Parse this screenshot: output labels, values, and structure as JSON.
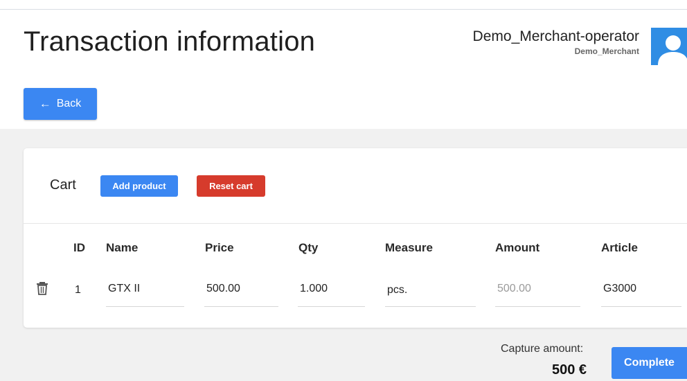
{
  "header": {
    "title": "Transaction information",
    "user_name": "Demo_Merchant-operator",
    "merchant": "Demo_Merchant"
  },
  "back_button": {
    "arrow": "←",
    "label": "Back"
  },
  "cart": {
    "title": "Cart",
    "add_product_label": "Add product",
    "reset_cart_label": "Reset cart",
    "columns": [
      "ID",
      "Name",
      "Price",
      "Qty",
      "Measure",
      "Amount",
      "Article"
    ],
    "rows": [
      {
        "id": "1",
        "name": "GTX II",
        "price": "500.00",
        "qty": "1.000",
        "measure": "pcs.",
        "amount": "500.00",
        "article": "G3000"
      }
    ]
  },
  "footer": {
    "capture_label": "Capture amount:",
    "capture_value": "500 €",
    "complete_label": "Complete"
  },
  "icons": {
    "back": "arrow-left-icon",
    "avatar": "user-avatar-icon",
    "delete": "trash-icon"
  },
  "colors": {
    "primary": "#3b87f2",
    "danger": "#d63b2c",
    "avatar_bg": "#2f8de4"
  }
}
